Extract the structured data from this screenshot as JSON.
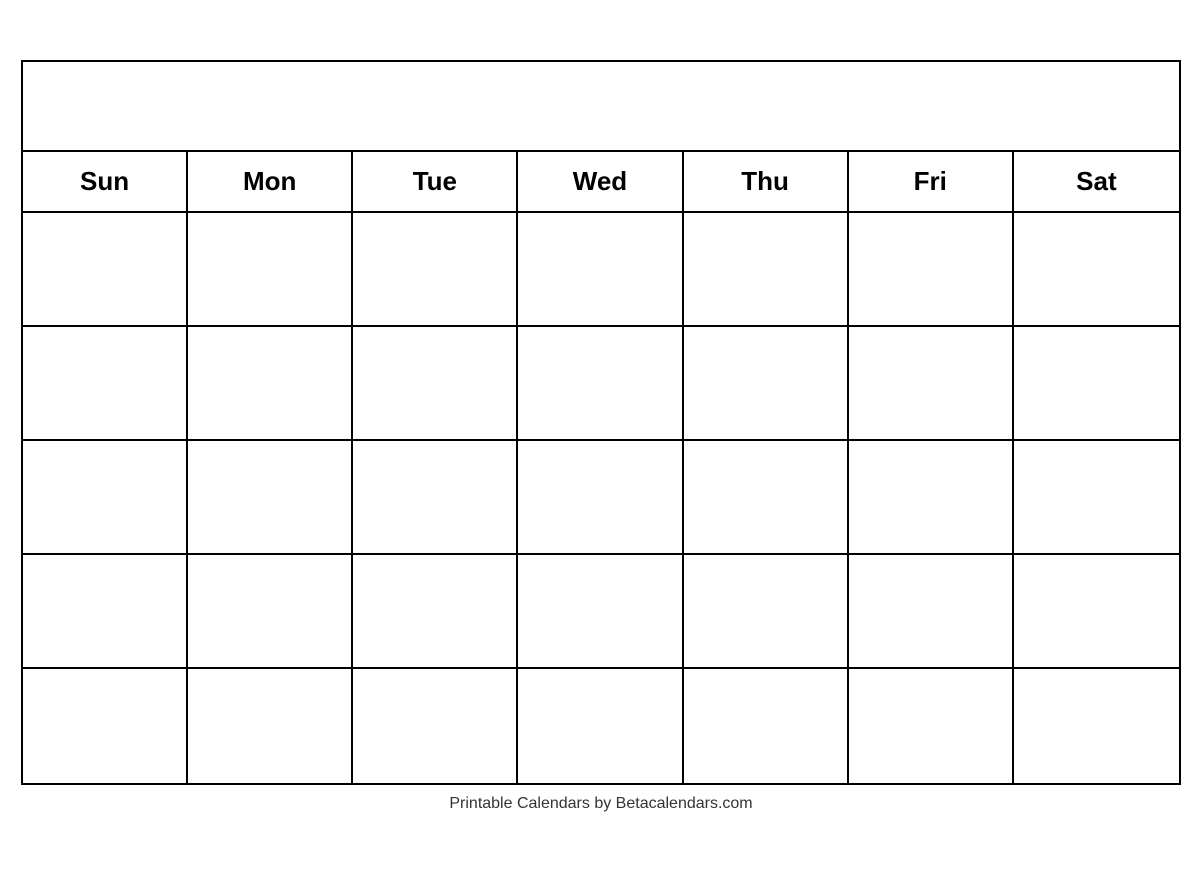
{
  "calendar": {
    "title": "",
    "days": [
      "Sun",
      "Mon",
      "Tue",
      "Wed",
      "Thu",
      "Fri",
      "Sat"
    ],
    "weeks": 5,
    "footer": "Printable Calendars by Betacalendars.com"
  }
}
